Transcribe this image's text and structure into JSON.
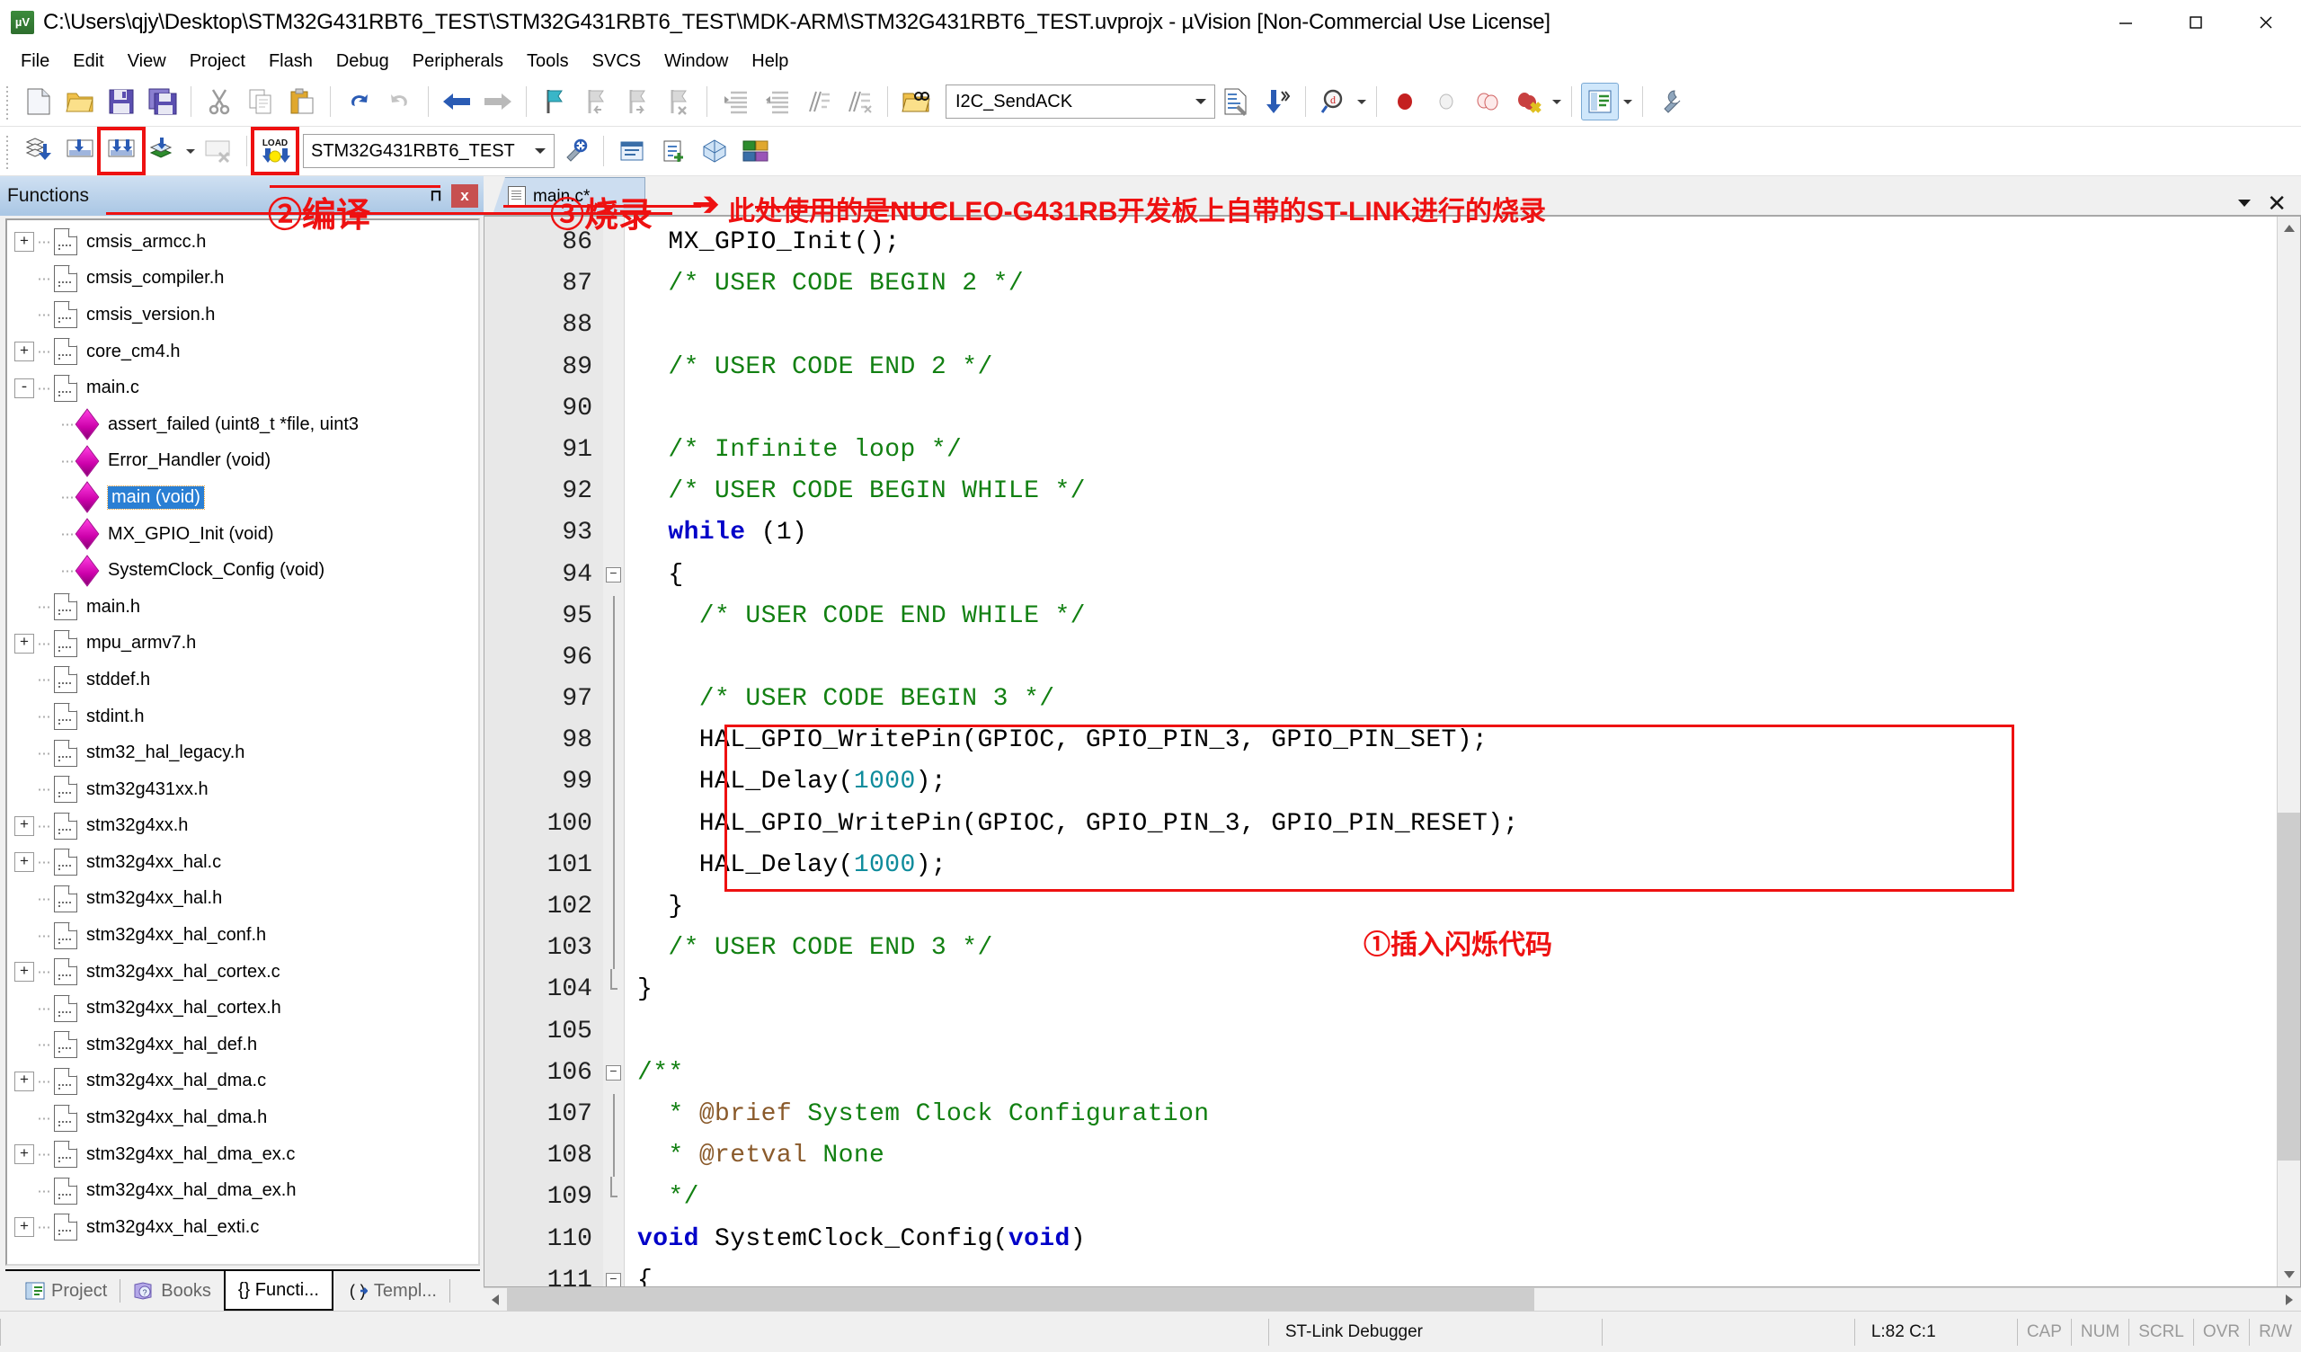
{
  "window": {
    "title": "C:\\Users\\qjy\\Desktop\\STM32G431RBT6_TEST\\STM32G431RBT6_TEST\\MDK-ARM\\STM32G431RBT6_TEST.uvprojx - µVision  [Non-Commercial Use License]",
    "app_icon": "uvision-icon",
    "minimize_label": "Minimize",
    "maximize_label": "Maximize",
    "close_label": "Close"
  },
  "menubar": {
    "items": [
      {
        "label": "File"
      },
      {
        "label": "Edit"
      },
      {
        "label": "View"
      },
      {
        "label": "Project"
      },
      {
        "label": "Flash"
      },
      {
        "label": "Debug"
      },
      {
        "label": "Peripherals"
      },
      {
        "label": "Tools"
      },
      {
        "label": "SVCS"
      },
      {
        "label": "Window"
      },
      {
        "label": "Help"
      }
    ]
  },
  "toolbar_file": {
    "search_value": "I2C_SendACK",
    "icons": [
      "new-file-icon",
      "open-file-icon",
      "save-icon",
      "save-all-icon",
      "cut-icon",
      "copy-icon",
      "paste-icon",
      "undo-icon",
      "redo-icon",
      "navigate-back-icon",
      "navigate-forward-icon",
      "bookmark-toggle-icon",
      "bookmark-prev-icon",
      "bookmark-next-icon",
      "bookmark-clear-icon",
      "indent-icon",
      "outdent-icon",
      "comment-icon",
      "uncomment-icon",
      "find-in-files-icon"
    ],
    "right_icons": [
      "configure-target-icon",
      "goto-definition-icon",
      "find-icon",
      "insert-breakpoint-icon",
      "disable-breakpoint-icon",
      "disable-all-breakpoints-icon",
      "kill-all-breakpoints-icon",
      "project-window-icon",
      "configuration-wizard-icon"
    ]
  },
  "toolbar_build": {
    "target_value": "STM32G431RBT6_TEST",
    "icons": [
      "translate-file-icon",
      "build-target-icon",
      "rebuild-all-icon",
      "batch-build-icon",
      "stop-build-icon",
      "download-icon"
    ],
    "right_icons": [
      "target-options-icon",
      "manage-runtime-icon",
      "new-item-icon",
      "pack-installer-icon",
      "manage-project-items-icon"
    ]
  },
  "annotations": {
    "compile": "②编译",
    "flash": "③烧录",
    "stlink_note": "此处使用的是NUCLEO-G431RB开发板上自带的ST-LINK进行的烧录",
    "insert_blink": "①插入闪烁代码",
    "color": "#ee1111"
  },
  "left_dock": {
    "title": "Functions",
    "pin_label": "⊓",
    "close_label": "x",
    "tabs": [
      {
        "label": "Project",
        "icon": "project-window-icon",
        "active": false
      },
      {
        "label": "Books",
        "icon": "books-icon",
        "active": false
      },
      {
        "label": "{} Functi...",
        "icon": "functions-icon",
        "active": true
      },
      {
        "label": "Templ...",
        "icon": "templates-icon",
        "active": false
      }
    ],
    "tree": [
      {
        "label": "cmsis_armcc.h",
        "indent": 1,
        "expander": "+",
        "icon": "file-icon",
        "selected": false
      },
      {
        "label": "cmsis_compiler.h",
        "indent": 1,
        "expander": "",
        "icon": "file-icon",
        "selected": false
      },
      {
        "label": "cmsis_version.h",
        "indent": 1,
        "expander": "",
        "icon": "file-icon",
        "selected": false
      },
      {
        "label": "core_cm4.h",
        "indent": 1,
        "expander": "+",
        "icon": "file-icon",
        "selected": false
      },
      {
        "label": "main.c",
        "indent": 1,
        "expander": "-",
        "icon": "file-icon",
        "selected": false
      },
      {
        "label": "assert_failed (uint8_t *file, uint3",
        "indent": 2,
        "expander": "",
        "icon": "function-icon",
        "selected": false
      },
      {
        "label": "Error_Handler (void)",
        "indent": 2,
        "expander": "",
        "icon": "function-icon",
        "selected": false
      },
      {
        "label": "main (void)",
        "indent": 2,
        "expander": "",
        "icon": "function-icon",
        "selected": true
      },
      {
        "label": "MX_GPIO_Init (void)",
        "indent": 2,
        "expander": "",
        "icon": "function-icon",
        "selected": false
      },
      {
        "label": "SystemClock_Config (void)",
        "indent": 2,
        "expander": "",
        "icon": "function-icon",
        "selected": false
      },
      {
        "label": "main.h",
        "indent": 1,
        "expander": "",
        "icon": "file-icon",
        "selected": false
      },
      {
        "label": "mpu_armv7.h",
        "indent": 1,
        "expander": "+",
        "icon": "file-icon",
        "selected": false
      },
      {
        "label": "stddef.h",
        "indent": 1,
        "expander": "",
        "icon": "file-icon",
        "selected": false
      },
      {
        "label": "stdint.h",
        "indent": 1,
        "expander": "",
        "icon": "file-icon",
        "selected": false
      },
      {
        "label": "stm32_hal_legacy.h",
        "indent": 1,
        "expander": "",
        "icon": "file-icon",
        "selected": false
      },
      {
        "label": "stm32g431xx.h",
        "indent": 1,
        "expander": "",
        "icon": "file-icon",
        "selected": false
      },
      {
        "label": "stm32g4xx.h",
        "indent": 1,
        "expander": "+",
        "icon": "file-icon",
        "selected": false
      },
      {
        "label": "stm32g4xx_hal.c",
        "indent": 1,
        "expander": "+",
        "icon": "file-icon",
        "selected": false
      },
      {
        "label": "stm32g4xx_hal.h",
        "indent": 1,
        "expander": "",
        "icon": "file-icon",
        "selected": false
      },
      {
        "label": "stm32g4xx_hal_conf.h",
        "indent": 1,
        "expander": "",
        "icon": "file-icon",
        "selected": false
      },
      {
        "label": "stm32g4xx_hal_cortex.c",
        "indent": 1,
        "expander": "+",
        "icon": "file-icon",
        "selected": false
      },
      {
        "label": "stm32g4xx_hal_cortex.h",
        "indent": 1,
        "expander": "",
        "icon": "file-icon",
        "selected": false
      },
      {
        "label": "stm32g4xx_hal_def.h",
        "indent": 1,
        "expander": "",
        "icon": "file-icon",
        "selected": false
      },
      {
        "label": "stm32g4xx_hal_dma.c",
        "indent": 1,
        "expander": "+",
        "icon": "file-icon",
        "selected": false
      },
      {
        "label": "stm32g4xx_hal_dma.h",
        "indent": 1,
        "expander": "",
        "icon": "file-icon",
        "selected": false
      },
      {
        "label": "stm32g4xx_hal_dma_ex.c",
        "indent": 1,
        "expander": "+",
        "icon": "file-icon",
        "selected": false
      },
      {
        "label": "stm32g4xx_hal_dma_ex.h",
        "indent": 1,
        "expander": "",
        "icon": "file-icon",
        "selected": false
      },
      {
        "label": "stm32g4xx_hal_exti.c",
        "indent": 1,
        "expander": "+",
        "icon": "file-icon",
        "selected": false
      }
    ]
  },
  "editor": {
    "tab_label": "main.c*",
    "first_line": 86,
    "lines": [
      {
        "n": 86,
        "fold": "",
        "segs": [
          {
            "t": "  MX_GPIO_Init();",
            "c": ""
          }
        ]
      },
      {
        "n": 87,
        "fold": "",
        "segs": [
          {
            "t": "  /* USER CODE BEGIN 2 */",
            "c": "cm"
          }
        ]
      },
      {
        "n": 88,
        "fold": "",
        "segs": [
          {
            "t": "",
            "c": ""
          }
        ]
      },
      {
        "n": 89,
        "fold": "",
        "segs": [
          {
            "t": "  /* USER CODE END 2 */",
            "c": "cm"
          }
        ]
      },
      {
        "n": 90,
        "fold": "",
        "segs": [
          {
            "t": "",
            "c": ""
          }
        ]
      },
      {
        "n": 91,
        "fold": "",
        "segs": [
          {
            "t": "  /* Infinite loop */",
            "c": "cm"
          }
        ]
      },
      {
        "n": 92,
        "fold": "",
        "segs": [
          {
            "t": "  /* USER CODE BEGIN WHILE */",
            "c": "cm"
          }
        ]
      },
      {
        "n": 93,
        "fold": "",
        "segs": [
          {
            "t": "  ",
            "c": ""
          },
          {
            "t": "while",
            "c": "kw"
          },
          {
            "t": " (1)",
            "c": ""
          }
        ]
      },
      {
        "n": 94,
        "fold": "-",
        "segs": [
          {
            "t": "  {",
            "c": ""
          }
        ]
      },
      {
        "n": 95,
        "fold": "|",
        "segs": [
          {
            "t": "    /* USER CODE END WHILE */",
            "c": "cm"
          }
        ]
      },
      {
        "n": 96,
        "fold": "|",
        "segs": [
          {
            "t": "",
            "c": ""
          }
        ]
      },
      {
        "n": 97,
        "fold": "|",
        "segs": [
          {
            "t": "    /* USER CODE BEGIN 3 */",
            "c": "cm"
          }
        ]
      },
      {
        "n": 98,
        "fold": "|",
        "segs": [
          {
            "t": "    HAL_GPIO_WritePin(GPIOC, GPIO_PIN_3, GPIO_PIN_SET);",
            "c": ""
          }
        ]
      },
      {
        "n": 99,
        "fold": "|",
        "segs": [
          {
            "t": "    HAL_Delay(",
            "c": ""
          },
          {
            "t": "1000",
            "c": "num"
          },
          {
            "t": ");",
            "c": ""
          }
        ]
      },
      {
        "n": 100,
        "fold": "|",
        "segs": [
          {
            "t": "    HAL_GPIO_WritePin(GPIOC, GPIO_PIN_3, GPIO_PIN_RESET);",
            "c": ""
          }
        ]
      },
      {
        "n": 101,
        "fold": "|",
        "segs": [
          {
            "t": "    HAL_Delay(",
            "c": ""
          },
          {
            "t": "1000",
            "c": "num"
          },
          {
            "t": ");",
            "c": ""
          }
        ]
      },
      {
        "n": 102,
        "fold": "|",
        "segs": [
          {
            "t": "  }",
            "c": ""
          }
        ]
      },
      {
        "n": 103,
        "fold": "|",
        "segs": [
          {
            "t": "  /* USER CODE END 3 */",
            "c": "cm"
          }
        ]
      },
      {
        "n": 104,
        "fold": "L",
        "segs": [
          {
            "t": "}",
            "c": ""
          }
        ]
      },
      {
        "n": 105,
        "fold": "",
        "segs": [
          {
            "t": "",
            "c": ""
          }
        ]
      },
      {
        "n": 106,
        "fold": "-",
        "segs": [
          {
            "t": "/**",
            "c": "cm"
          }
        ]
      },
      {
        "n": 107,
        "fold": "|",
        "segs": [
          {
            "t": "  * ",
            "c": "cm"
          },
          {
            "t": "@brief",
            "c": "dockw"
          },
          {
            "t": " System Clock Configuration",
            "c": "cm"
          }
        ]
      },
      {
        "n": 108,
        "fold": "|",
        "segs": [
          {
            "t": "  * ",
            "c": "cm"
          },
          {
            "t": "@retval",
            "c": "dockw"
          },
          {
            "t": " None",
            "c": "cm"
          }
        ]
      },
      {
        "n": 109,
        "fold": "L",
        "segs": [
          {
            "t": "  */",
            "c": "cm"
          }
        ]
      },
      {
        "n": 110,
        "fold": "",
        "segs": [
          {
            "t": "",
            "c": ""
          },
          {
            "t": "void",
            "c": "kw"
          },
          {
            "t": " SystemClock_Config(",
            "c": ""
          },
          {
            "t": "void",
            "c": "kw"
          },
          {
            "t": ")",
            "c": ""
          }
        ]
      },
      {
        "n": 111,
        "fold": "-",
        "segs": [
          {
            "t": "{",
            "c": ""
          }
        ]
      }
    ]
  },
  "statusbar": {
    "debugger": "ST-Link Debugger",
    "position": "L:82 C:1",
    "flags": [
      "CAP",
      "NUM",
      "SCRL",
      "OVR",
      "R/W"
    ]
  }
}
